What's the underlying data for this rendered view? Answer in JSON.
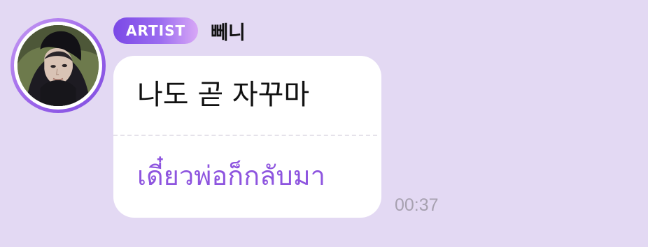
{
  "message": {
    "badge_label": "ARTIST",
    "sender_name": "뻬니",
    "text": "나도 곧 자꾸마",
    "translation": "เดี๋ยวพ่อก็กลับมา",
    "timestamp": "00:37"
  },
  "colors": {
    "background": "#e3d9f3",
    "badge_start": "#7a49e6",
    "badge_end": "#d8a8f6",
    "translation_text": "#8e55df",
    "timestamp_text": "#a7a1b0"
  },
  "icons": {
    "avatar": "artist-avatar-photo"
  }
}
